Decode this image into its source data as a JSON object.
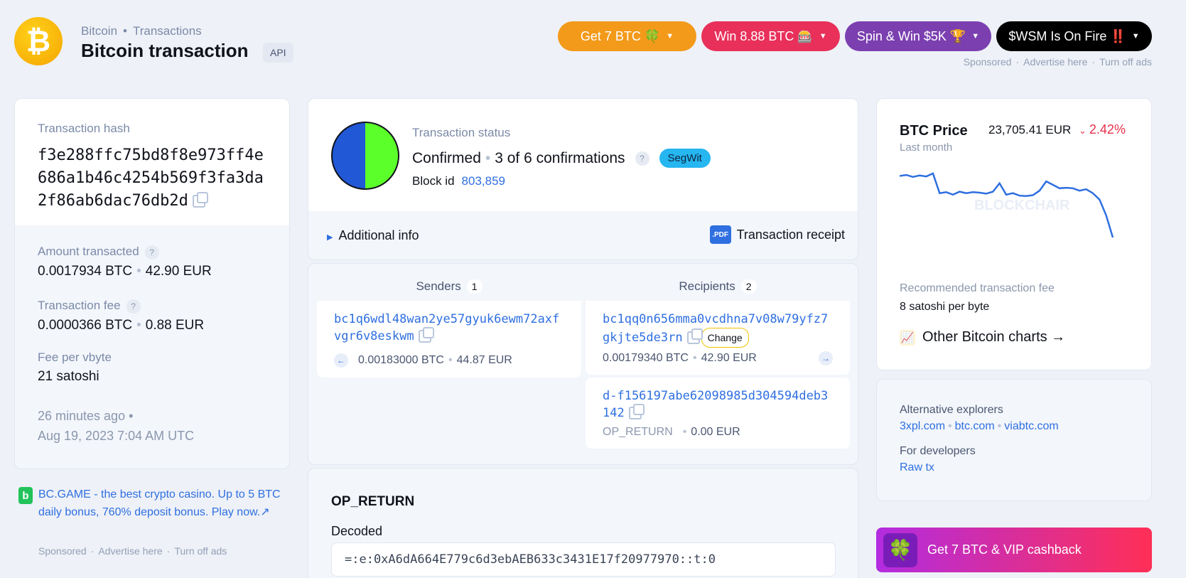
{
  "header": {
    "logo_glyph": "₿",
    "breadcrumb": [
      "Bitcoin",
      "Transactions"
    ],
    "title": "Bitcoin transaction",
    "api_badge": "API"
  },
  "promos": [
    {
      "label": "Get 7 BTC 🍀",
      "color": "#f39a1a"
    },
    {
      "label": "Win 8.88 BTC 🎰",
      "color": "#e8305a"
    },
    {
      "label": "Spin & Win $5K 🏆",
      "color": "#7b3fb0"
    },
    {
      "label": "$WSM Is On Fire ‼️",
      "color": "#000000"
    }
  ],
  "ad_links": {
    "sponsored": "Sponsored",
    "advertise": "Advertise here",
    "turn_off": "Turn off ads"
  },
  "tx": {
    "hash_label": "Transaction hash",
    "hash": "f3e288ffc75bd8f8e973ff4e686a1b46c4254b569f3fa3da2f86ab6dac76db2d",
    "amount_label": "Amount transacted",
    "amount_btc": "0.0017934 BTC",
    "amount_eur": "42.90 EUR",
    "fee_label": "Transaction fee",
    "fee_btc": "0.0000366 BTC",
    "fee_eur": "0.88 EUR",
    "fpv_label": "Fee per vbyte",
    "fpv": "21 satoshi",
    "ago": "26 minutes ago",
    "date": "Aug 19, 2023 7:04 AM UTC"
  },
  "bc_ad": {
    "logo": "b",
    "text": "BC.GAME - the best crypto casino. Up to 5 BTC daily bonus, 760% deposit bonus. Play now.↗"
  },
  "status": {
    "label": "Transaction status",
    "state": "Confirmed",
    "confirmations": "3 of 6 confirmations",
    "segwit": "SegWit",
    "block_label": "Block id",
    "block_id": "803,859",
    "confirm_fraction": 0.5,
    "additional": "Additional info",
    "pdf": ".PDF",
    "receipt": "Transaction receipt"
  },
  "senders": {
    "label": "Senders",
    "count": "1",
    "items": [
      {
        "address": "bc1q6wdl48wan2ye57gyuk6ewm72axfvgr6v8eskwm",
        "btc": "0.00183000 BTC",
        "eur": "44.87 EUR"
      }
    ]
  },
  "recipients": {
    "label": "Recipients",
    "count": "2",
    "items": [
      {
        "address": "bc1qq0n656mma0vcdhna7v08w79yfz7gkjte5de3rn",
        "badge": "Change",
        "btc": "0.00179340 BTC",
        "eur": "42.90 EUR"
      },
      {
        "address": "d-f156197abe62098985d304594deb3142",
        "type": "OP_RETURN",
        "eur": "0.00 EUR"
      }
    ]
  },
  "op_return": {
    "title": "OP_RETURN",
    "decoded_label": "Decoded",
    "decoded": "=:e:0xA6dA664E779c6d3ebAEB633c3431E17f20977970::t:0"
  },
  "price": {
    "title": "BTC Price",
    "subtitle": "Last month",
    "value": "23,705.41 EUR",
    "change": "2.42%",
    "change_color": "#e8304b",
    "watermark": "BLOCKCHAIR",
    "fee_label": "Recommended transaction fee",
    "fee_value": "8 satoshi per byte",
    "other_charts": "Other Bitcoin charts →"
  },
  "chart_data": {
    "type": "line",
    "title": "BTC Price",
    "subtitle": "Last month",
    "values": [
      0.9,
      0.92,
      0.88,
      0.91,
      0.89,
      0.95,
      0.55,
      0.57,
      0.52,
      0.58,
      0.55,
      0.57,
      0.56,
      0.54,
      0.58,
      0.75,
      0.52,
      0.55,
      0.5,
      0.49,
      0.51,
      0.6,
      0.79,
      0.72,
      0.65,
      0.66,
      0.65,
      0.6,
      0.63,
      0.55,
      0.42,
      0.1,
      -0.35
    ]
  },
  "alt": {
    "explorers_label": "Alternative explorers",
    "explorers": [
      "3xpl.com",
      "btc.com",
      "viabtc.com"
    ],
    "dev_label": "For developers",
    "raw_tx": "Raw tx"
  },
  "vip_ad": {
    "icon": "🍀",
    "label": "Get 7 BTC & VIP cashback"
  }
}
